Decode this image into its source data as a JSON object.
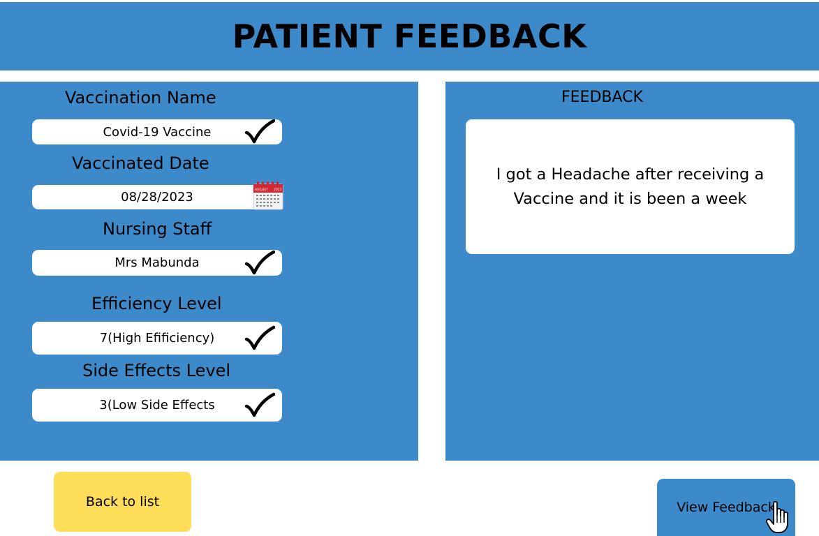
{
  "header": {
    "title": "PATIENT FEEDBACK"
  },
  "form": {
    "vaccination_name": {
      "label": "Vaccination Name",
      "value": "Covid-19 Vaccine",
      "icon": "check-icon"
    },
    "vaccinated_date": {
      "label": "Vaccinated Date",
      "value": "08/28/2023",
      "icon": "calendar-icon",
      "calendar_month": "AUGUST",
      "calendar_year": "2023"
    },
    "nursing_staff": {
      "label": "Nursing Staff",
      "value": "Mrs Mabunda",
      "icon": "check-icon"
    },
    "efficiency_level": {
      "label": "Efficiency Level",
      "value": "7(High Efificiency)",
      "icon": "check-icon"
    },
    "side_effects_level": {
      "label": "Side Effects Level",
      "value": "3(Low Side Effects",
      "icon": "check-icon"
    }
  },
  "feedback": {
    "title": "FEEDBACK",
    "text": "I got a Headache after receiving a Vaccine and it is been a week"
  },
  "buttons": {
    "back": "Back to list",
    "view": "View Feedback"
  },
  "colors": {
    "panel": "#3d8acb",
    "back_button": "#fedd58",
    "background": "#ffffff"
  }
}
